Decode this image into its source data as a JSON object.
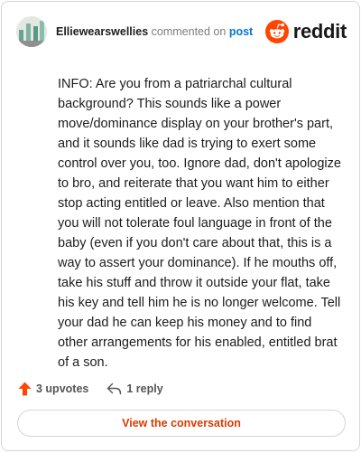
{
  "header": {
    "username": "Elliewearswellies",
    "action_text": "commented on",
    "target": "post",
    "brand": "reddit"
  },
  "comment": {
    "text": "INFO: Are you from a patriarchal cultural background? This sounds like a power move/dominance display on your brother's part, and it sounds like dad is trying to exert some control over you, too. Ignore dad, don't apologize to bro, and reiterate that you want him to either stop acting entitled or leave. Also mention that you will not tolerate foul language in front of the baby (even if you don't care about that, this is a way to assert your dominance). If he mouths off, take his stuff and throw it outside your flat, take his key and tell him he is no longer welcome. Tell your dad he can keep his money and to find other arrangements for his enabled, entitled brat of a son."
  },
  "actions": {
    "upvotes": "3 upvotes",
    "replies": "1 reply"
  },
  "footer": {
    "view_conversation": "View the conversation"
  },
  "colors": {
    "brand_orange": "#ff4500",
    "link_blue": "#0079d3",
    "button_text": "#d93a00"
  },
  "icons": {
    "avatar": "avatar",
    "brand": "reddit-logo-icon",
    "upvote": "upvote-arrow-icon",
    "reply": "reply-arrow-icon"
  }
}
